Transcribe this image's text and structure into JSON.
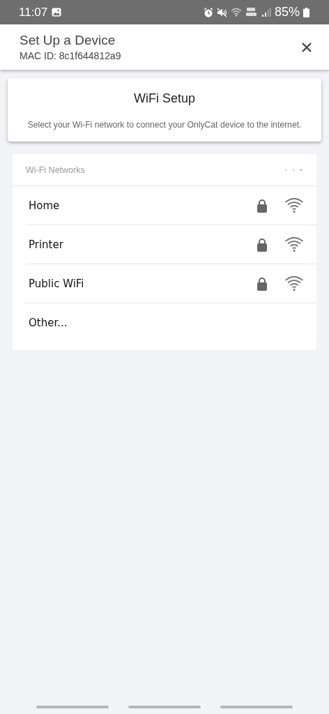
{
  "status_bar": {
    "time": "11:07",
    "battery": "85%"
  },
  "header": {
    "title": "Set Up a Device",
    "subtitle": "MAC ID: 8c1f644812a9"
  },
  "setup_card": {
    "title": "WiFi Setup",
    "description": "Select your Wi-Fi network to connect your OnlyCat device to the internet."
  },
  "networks": {
    "heading": "Wi-Fi Networks",
    "items": [
      {
        "kind": "network",
        "name": "Home",
        "secured": true
      },
      {
        "kind": "network",
        "name": "Printer",
        "secured": true
      },
      {
        "kind": "network",
        "name": "Public WiFi",
        "secured": true
      },
      {
        "kind": "other",
        "name": "Other..."
      }
    ]
  }
}
